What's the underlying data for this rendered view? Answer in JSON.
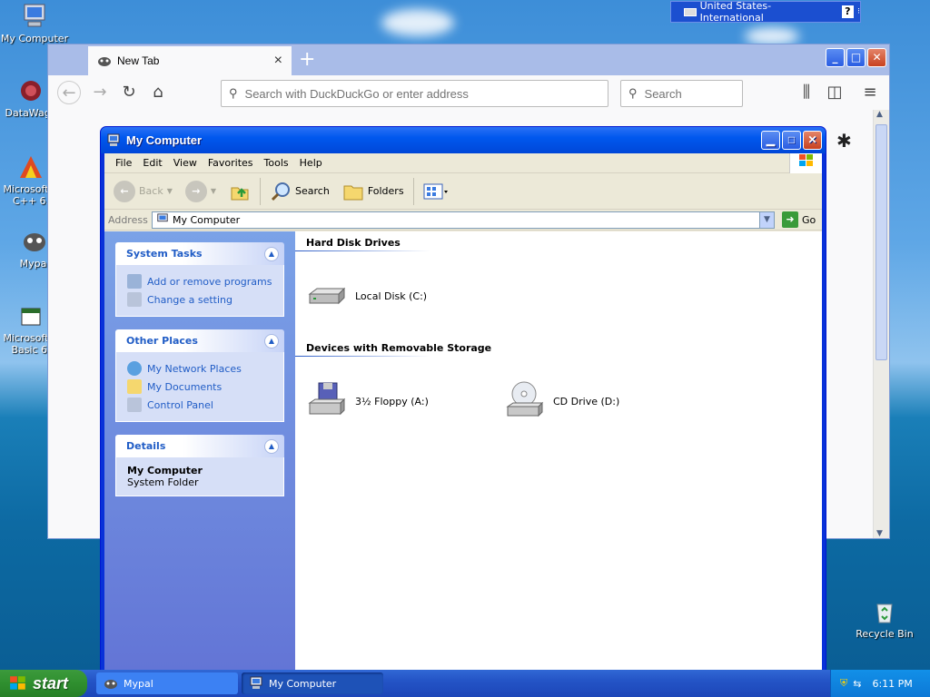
{
  "desktop": {
    "icons": [
      {
        "label": "My Computer",
        "icon": "computer-icon"
      },
      {
        "label": "DataWago",
        "icon": "datawago-icon"
      },
      {
        "label": "Microsoft V C++ 6.",
        "icon": "msvc-icon"
      },
      {
        "label": "Mypal",
        "icon": "mypal-icon"
      },
      {
        "label": "Microsoft V Basic 6.",
        "icon": "vb-icon"
      },
      {
        "label": "Recycle Bin",
        "icon": "recycle-bin-icon"
      }
    ]
  },
  "langbar": {
    "label": "United States-International",
    "help": "?"
  },
  "browser": {
    "tab_title": "New Tab",
    "tab_close": "×",
    "new_tab": "+",
    "url_placeholder": "Search with DuckDuckGo or enter address",
    "search_placeholder": "Search",
    "win_min": "_",
    "win_max": "□",
    "win_close": "✕"
  },
  "explorer": {
    "title": "My Computer",
    "menu": [
      "File",
      "Edit",
      "View",
      "Favorites",
      "Tools",
      "Help"
    ],
    "toolbar": {
      "back": "Back",
      "search": "Search",
      "folders": "Folders"
    },
    "address_label": "Address",
    "address_value": "My Computer",
    "go": "Go",
    "system_tasks": {
      "title": "System Tasks",
      "links": [
        "Add or remove programs",
        "Change a setting"
      ]
    },
    "other_places": {
      "title": "Other Places",
      "links": [
        "My Network Places",
        "My Documents",
        "Control Panel"
      ]
    },
    "details": {
      "title": "Details",
      "name": "My Computer",
      "type": "System Folder"
    },
    "groups": [
      {
        "title": "Hard Disk Drives",
        "items": [
          "Local Disk (C:)"
        ]
      },
      {
        "title": "Devices with Removable Storage",
        "items": [
          "3½ Floppy (A:)",
          "CD Drive (D:)"
        ]
      }
    ]
  },
  "taskbar": {
    "start": "start",
    "tasks": [
      "Mypal",
      "My Computer"
    ],
    "clock": "6:11 PM"
  }
}
